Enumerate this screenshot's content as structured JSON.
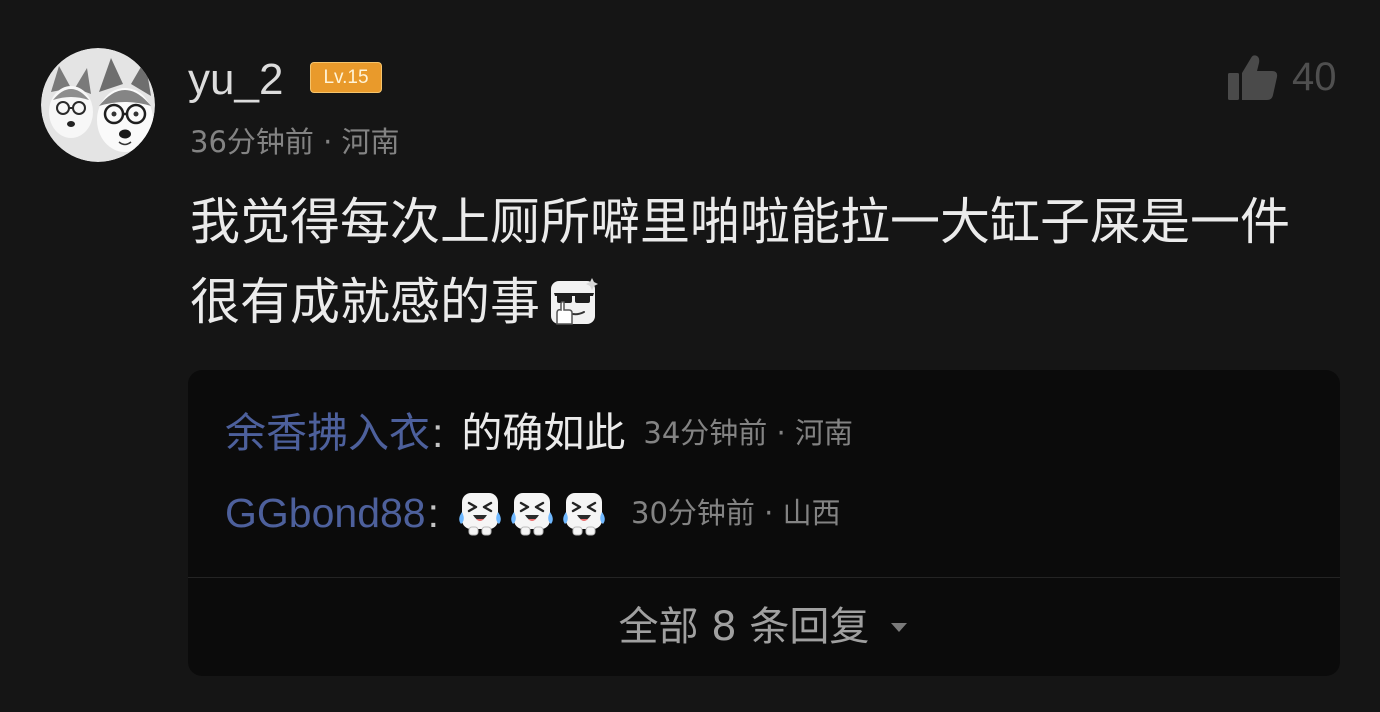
{
  "colors": {
    "page_background": "#151515",
    "reply_box_background": "#0b0b0b",
    "primary_text": "#ebebeb",
    "username_text": "#dcdcdc",
    "secondary_text": "#838383",
    "reply_author": "#4d609c",
    "level_badge": "#e99a2b",
    "like_icon": "#4f4f4f"
  },
  "comment": {
    "avatar_icon": "husky-dogs-avatar",
    "username": "yu_2",
    "level_badge": "Lv.15",
    "meta": "36分钟前 · 河南",
    "text_lines": [
      "我觉得每次上厕所噼里啪啦能拉一大缸子屎是一件",
      "很有成就感的事"
    ],
    "trailing_sticker": "cool-glasses-sticker",
    "like_icon": "thumbs-up-icon",
    "like_count": "40"
  },
  "replies": [
    {
      "author": "余香拂入衣",
      "colon": ":",
      "text": "的确如此",
      "meta": "34分钟前 · 河南"
    },
    {
      "author": "GGbond88",
      "colon": ":",
      "stickers": [
        "laugh-cry-sticker",
        "laugh-cry-sticker",
        "laugh-cry-sticker"
      ],
      "meta": "30分钟前 · 山西"
    }
  ],
  "view_all": {
    "label": "全部 8 条回复",
    "icon": "caret-down-icon"
  }
}
